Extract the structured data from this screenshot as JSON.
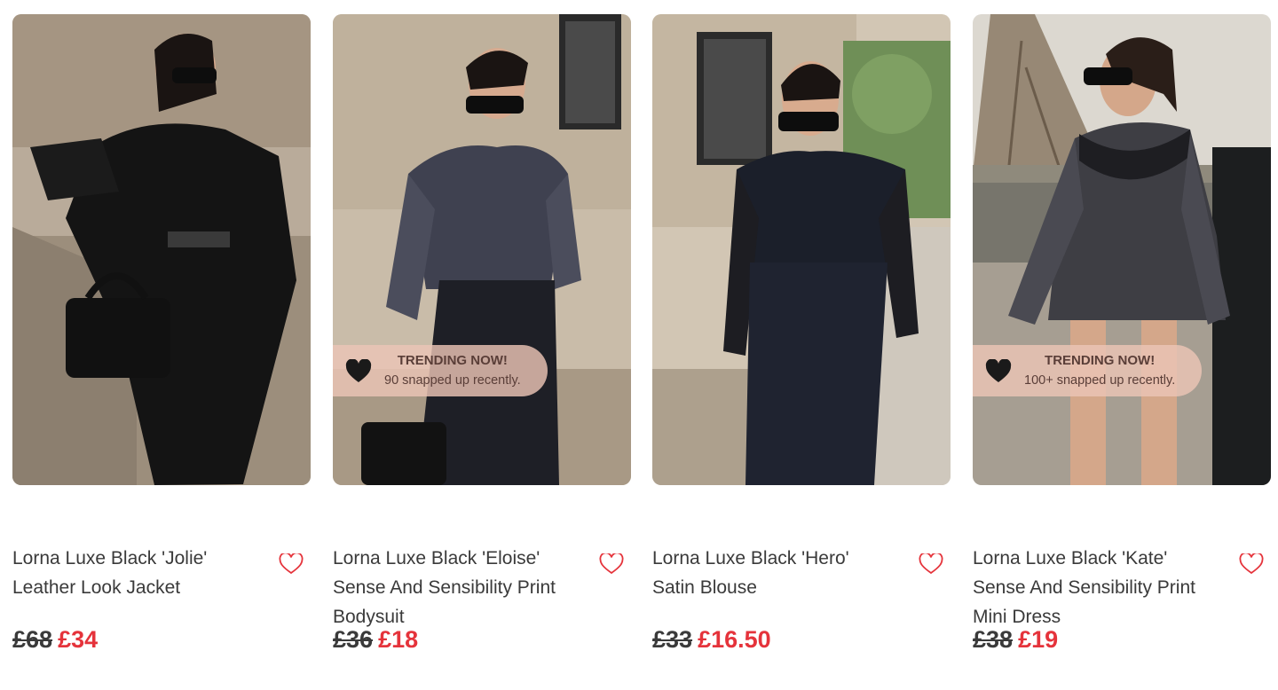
{
  "colors": {
    "sale_price": "#e5333b",
    "text": "#3a3a3a",
    "wishlist_outline": "#e5333b",
    "trending_badge_bg": "#ecc4b6"
  },
  "products": [
    {
      "title": "Lorna Luxe Black 'Jolie' Leather Look Jacket",
      "old_price": "£68",
      "price": "£34",
      "trending": null,
      "wishlist_icon": "heart-outline-icon"
    },
    {
      "title": "Lorna Luxe Black 'Eloise' Sense And Sensibility Print Bodysuit",
      "old_price": "£36",
      "price": "£18",
      "trending": {
        "title": "TRENDING NOW!",
        "subtitle": "90 snapped up recently."
      },
      "wishlist_icon": "heart-outline-icon"
    },
    {
      "title": "Lorna Luxe Black 'Hero' Satin Blouse",
      "old_price": "£33",
      "price": "£16.50",
      "trending": null,
      "wishlist_icon": "heart-outline-icon"
    },
    {
      "title": "Lorna Luxe Black 'Kate' Sense And Sensibility Print Mini Dress",
      "old_price": "£38",
      "price": "£19",
      "trending": {
        "title": "TRENDING NOW!",
        "subtitle": "100+ snapped up recently."
      },
      "wishlist_icon": "heart-outline-icon"
    }
  ]
}
